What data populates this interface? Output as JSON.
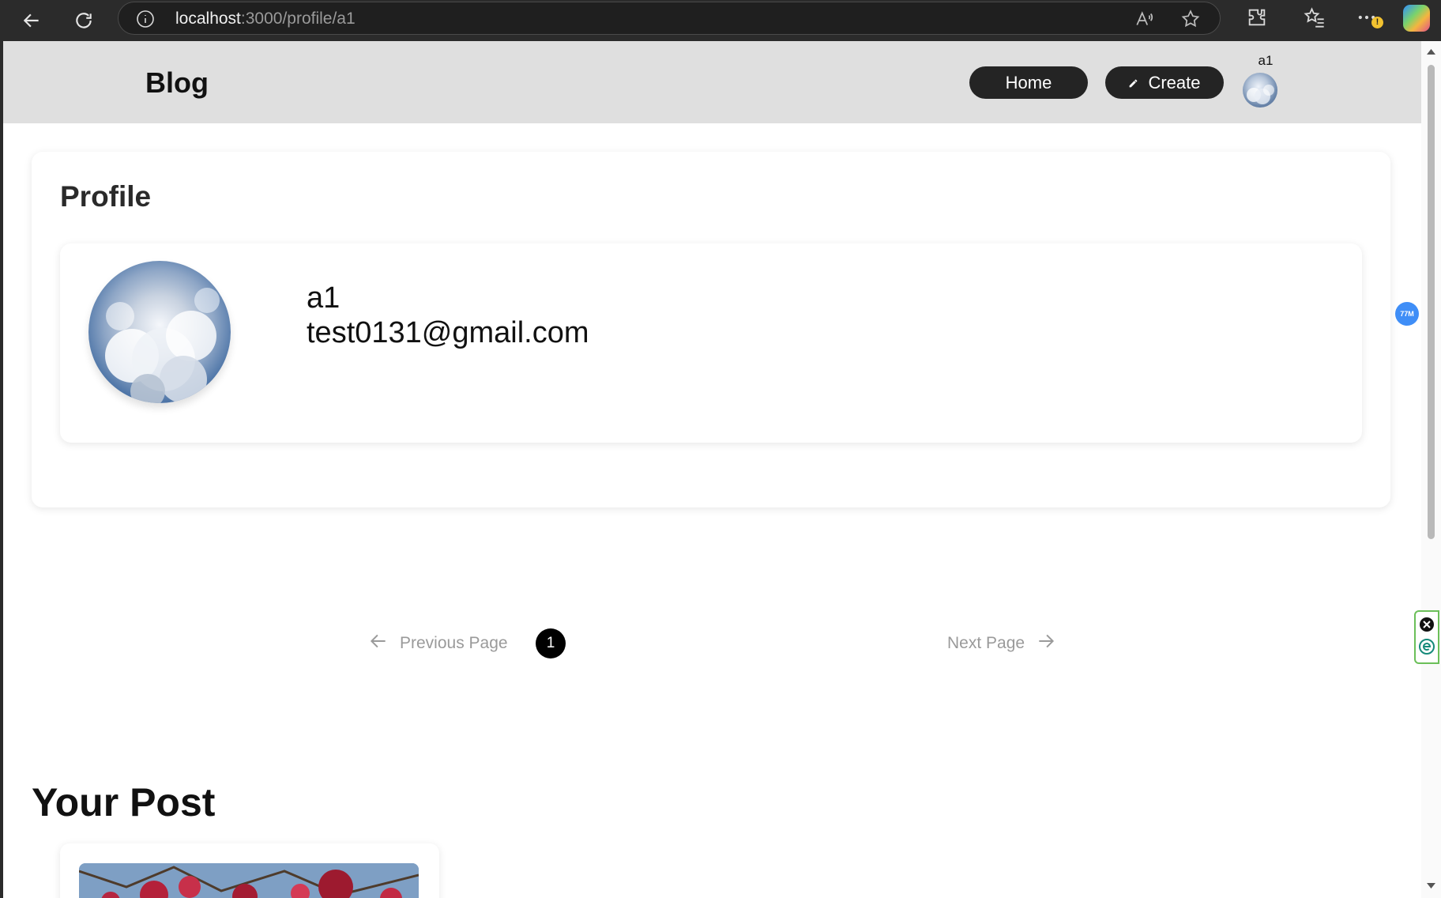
{
  "browser": {
    "url_host": "localhost",
    "url_path": ":3000/profile/a1"
  },
  "header": {
    "brand": "Blog",
    "home_label": "Home",
    "create_label": "Create",
    "username": "a1"
  },
  "profile": {
    "title": "Profile",
    "name": "a1",
    "email": "test0131@gmail.com"
  },
  "pagination": {
    "prev_label": "Previous Page",
    "current_page": "1",
    "next_label": "Next Page"
  },
  "posts": {
    "title": "Your Post"
  },
  "side_widget": {
    "badge": "77M"
  },
  "colors": {
    "header_bg": "#dfdfdf",
    "pill_bg": "#242424",
    "page_bg": "#ffffff"
  }
}
